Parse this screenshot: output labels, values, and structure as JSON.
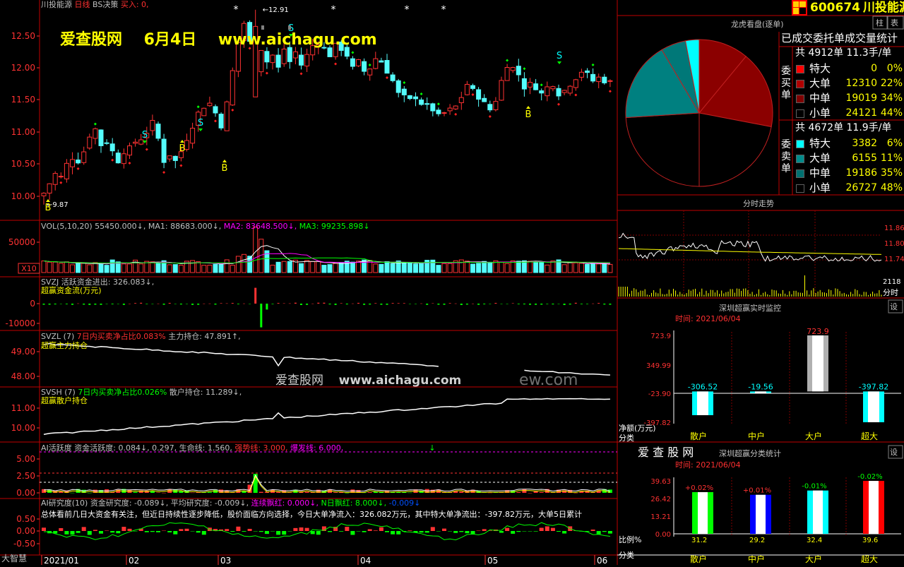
{
  "stock": {
    "code": "600674",
    "name": "川投能源",
    "period": "日线",
    "strategy": "BS决策",
    "buy": "买入: 0,"
  },
  "watermark": {
    "site": "爱查股网",
    "date": "6月4日",
    "url": "www.aichagu.com",
    "mid": "爱查股网",
    "mid_url": "www.aichagu.com",
    "mid_tail": "ew.com"
  },
  "main": {
    "high_label": "12.91",
    "low_label": "9.87",
    "yticks": [
      "12.50",
      "12.00",
      "11.50",
      "11.00",
      "10.50",
      "10.00"
    ]
  },
  "signals": {
    "buy": "B",
    "sell": "S"
  },
  "vol": {
    "header": "VOL(5,10,20) 55450.000↓, MA1: 88683.000↓, MA2: 83648.500↓, MA3: 99235.898↓",
    "parts": [
      {
        "t": "VOL(5,10,20) 55450.000↓, MA1: 88683.000↓, ",
        "c": "#c0c0c0"
      },
      {
        "t": "MA2: 83648.500↓, ",
        "c": "#ff00ff"
      },
      {
        "t": "MA3: 99235.898↓",
        "c": "#00ff00"
      }
    ],
    "ytick": "50000",
    "unit": "X10"
  },
  "svzj": {
    "line1": "SVZJ  活跃资金进出: 326.083↓,",
    "line2": "超赢资金流(万元)",
    "yticks": [
      "0",
      "-10000"
    ]
  },
  "svzl": {
    "line1_a": "SVZL (7) ",
    "line1_b": "7日内买卖净占比0.083%",
    "line1_c": " 主力持仓: 47.891↑,",
    "line2": "超赢主力持仓",
    "yticks": [
      "49.00",
      "48.00"
    ]
  },
  "svsh": {
    "line1_a": "SVSH (7) ",
    "line1_b": "7日内买卖净占比0.026%",
    "line1_c": " 散户持仓: 11.289↓,",
    "line2": "超赢散户持仓",
    "yticks": [
      "11.00",
      "10.00"
    ]
  },
  "ai1": {
    "a": "AI活跃度 资金活跃度: 0.084↓, 0.297, 生命线: 1.560, ",
    "b": "强势线: 3.000, ",
    "c": "爆发线: 6.000,",
    "yticks": [
      "5.00",
      "2.50",
      "0.00"
    ]
  },
  "ai2": {
    "a": "AI研究度(10) 资金研究度: -0.089↓, 平均研究度: -0.009↓, ",
    "b": "连续飘红: 0.000↓, ",
    "c": "N日飘红: 8.000↓, ",
    "d": "-0.009↓",
    "summary": "总体看前几日大资金有关注，但近日持续性逐步降低，股价面临方向选择，今日大单净流入：326.082万元，其中特大单净流出：-397.82万元，大单5日累计",
    "yticks": [
      "0.50",
      "0.00",
      "-0.50"
    ]
  },
  "xaxis": [
    "2021/01",
    "02",
    "03",
    "04",
    "05",
    "06"
  ],
  "brand": "大智慧",
  "right": {
    "tabs": [
      "柱",
      "表"
    ],
    "pie_title": "龙虎看盘(逐单)",
    "stats_header": "已成交委托单成交量统计",
    "buy": {
      "label": "委买单",
      "total": "共 4912单 11.3手/单",
      "rows": [
        {
          "name": "特大",
          "qty": "0",
          "pct": "0%",
          "color": "#ff0000"
        },
        {
          "name": "大单",
          "qty": "12310",
          "pct": "22%",
          "color": "#b00000"
        },
        {
          "name": "中单",
          "qty": "19019",
          "pct": "34%",
          "color": "#800000"
        },
        {
          "name": "小单",
          "qty": "24121",
          "pct": "44%",
          "color": "#000000"
        }
      ]
    },
    "sell": {
      "label": "委卖单",
      "total": "共 4672单 11.9手/单",
      "rows": [
        {
          "name": "特大",
          "qty": "3382",
          "pct": "6%",
          "color": "#00ffff"
        },
        {
          "name": "大单",
          "qty": "6155",
          "pct": "11%",
          "color": "#008b8b"
        },
        {
          "name": "中单",
          "qty": "19186",
          "pct": "35%",
          "color": "#007070"
        },
        {
          "name": "小单",
          "qty": "26727",
          "pct": "48%",
          "color": "#000000"
        }
      ]
    },
    "pie_slices": [
      {
        "v": 22,
        "c": "#8b0000"
      },
      {
        "v": 34,
        "c": "#8b0000"
      },
      {
        "v": 44,
        "c": "#000000"
      },
      {
        "v": 48,
        "c": "#000000"
      },
      {
        "v": 35,
        "c": "#008080"
      },
      {
        "v": 11,
        "c": "#007878"
      },
      {
        "v": 6,
        "c": "#00ffff"
      }
    ],
    "intraday": {
      "title": "分时走势",
      "yticks": [
        "11.86",
        "11.80",
        "11.74"
      ],
      "vol": "2118",
      "vol_unit": "分时"
    },
    "monitor1": {
      "title": "深圳超赢实时监控",
      "set": "设",
      "time_label": "时间: 2021/06/04",
      "yticks": [
        "723.9",
        "349.99",
        "-23.90",
        "-397.82"
      ],
      "ylabel": "净额(万元)",
      "xlabel": "分类",
      "values": [
        -306.52,
        -19.56,
        723.9,
        -397.82
      ],
      "labels": [
        "-306.52",
        "-19.56",
        "723.9",
        "-397.82"
      ],
      "cats": [
        "散户",
        "中户",
        "大户",
        "超大"
      ]
    },
    "monitor2": {
      "title": "深圳超赢分类统计",
      "brand": "爱 查 股 网",
      "set": "设",
      "time_label": "时间: 2021/06/04",
      "yticks": [
        "39.63",
        "26.42",
        "13.21",
        "0.00"
      ],
      "ylabel": "比例%",
      "xlabel": "分类",
      "values": [
        31.2,
        29.2,
        32.4,
        39.6
      ],
      "labels": [
        "31.2",
        "29.2",
        "32.4",
        "39.6"
      ],
      "deltas": [
        "+0.02%",
        "+0.01%",
        "-0.01%",
        "-0.02%"
      ],
      "cats": [
        "散户",
        "中户",
        "大户",
        "超大"
      ],
      "colors": [
        "#00ff00",
        "#0000ff",
        "#00ffff",
        "#ff0000"
      ]
    }
  }
}
